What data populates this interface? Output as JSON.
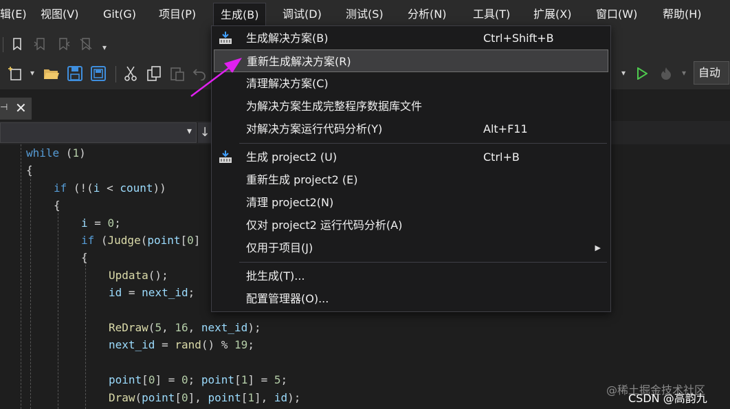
{
  "menubar": {
    "items": [
      {
        "label": "辑(E)"
      },
      {
        "label": "视图(V)"
      },
      {
        "label": "Git(G)"
      },
      {
        "label": "项目(P)"
      },
      {
        "label": "生成(B)"
      },
      {
        "label": "调试(D)"
      },
      {
        "label": "测试(S)"
      },
      {
        "label": "分析(N)"
      },
      {
        "label": "工具(T)"
      },
      {
        "label": "扩展(X)"
      },
      {
        "label": "窗口(W)"
      },
      {
        "label": "帮助(H)"
      }
    ]
  },
  "toolbar": {
    "config_label": "自动",
    "icons": [
      "bookmark-icon",
      "bookmark-prev-icon",
      "bookmark-next-icon",
      "bookmark-clear-icon",
      "overflow-icon",
      "new-project-icon",
      "open-folder-icon",
      "save-icon",
      "save-all-icon",
      "cut-icon",
      "copy-icon",
      "paste-icon",
      "undo-icon",
      "start-icon",
      "hot-reload-icon"
    ]
  },
  "build_menu": {
    "items": [
      {
        "label": "生成解决方案(B)",
        "shortcut": "Ctrl+Shift+B",
        "icon": "build-icon"
      },
      {
        "label": "重新生成解决方案(R)",
        "shortcut": "",
        "highlighted": true
      },
      {
        "label": "清理解决方案(C)",
        "shortcut": ""
      },
      {
        "label": "为解决方案生成完整程序数据库文件",
        "shortcut": ""
      },
      {
        "label": "对解决方案运行代码分析(Y)",
        "shortcut": "Alt+F11"
      },
      {
        "label": "生成 project2 (U)",
        "shortcut": "Ctrl+B",
        "icon": "build-icon"
      },
      {
        "label": "重新生成 project2 (E)",
        "shortcut": ""
      },
      {
        "label": "清理 project2(N)",
        "shortcut": ""
      },
      {
        "label": "仅对 project2 运行代码分析(A)",
        "shortcut": ""
      },
      {
        "label": "仅用于项目(J)",
        "shortcut": "",
        "submenu": true
      },
      {
        "label": "批生成(T)...",
        "shortcut": ""
      },
      {
        "label": "配置管理器(O)...",
        "shortcut": ""
      }
    ]
  },
  "code": {
    "lines": [
      {
        "parts": [
          [
            "kw",
            "while"
          ],
          [
            "pl",
            " ("
          ],
          [
            "num",
            "1"
          ],
          [
            "pl",
            ")"
          ]
        ]
      },
      {
        "parts": [
          [
            "pl",
            "{"
          ]
        ]
      },
      {
        "parts": [
          [
            "kw",
            "if"
          ],
          [
            "pl",
            " (!("
          ],
          [
            "var",
            "i"
          ],
          [
            "pl",
            " < "
          ],
          [
            "var",
            "count"
          ],
          [
            "pl",
            "))"
          ]
        ]
      },
      {
        "parts": [
          [
            "pl",
            "{"
          ]
        ]
      },
      {
        "parts": [
          [
            "var",
            "i"
          ],
          [
            "pl",
            " = "
          ],
          [
            "num",
            "0"
          ],
          [
            "pl",
            ";"
          ]
        ]
      },
      {
        "parts": [
          [
            "kw",
            "if"
          ],
          [
            "pl",
            " ("
          ],
          [
            "fn",
            "Judge"
          ],
          [
            "pl",
            "("
          ],
          [
            "var",
            "point"
          ],
          [
            "pl",
            "["
          ],
          [
            "num",
            "0"
          ],
          [
            "pl",
            "]"
          ]
        ]
      },
      {
        "parts": [
          [
            "pl",
            "{"
          ]
        ]
      },
      {
        "parts": [
          [
            "fn",
            "Updata"
          ],
          [
            "pl",
            "();"
          ]
        ]
      },
      {
        "parts": [
          [
            "var",
            "id"
          ],
          [
            "pl",
            " = "
          ],
          [
            "var",
            "next_id"
          ],
          [
            "pl",
            ";"
          ]
        ]
      },
      {
        "parts": [
          [
            "pl",
            ""
          ]
        ]
      },
      {
        "parts": [
          [
            "fn",
            "ReDraw"
          ],
          [
            "pl",
            "("
          ],
          [
            "num",
            "5"
          ],
          [
            "pl",
            ", "
          ],
          [
            "num",
            "16"
          ],
          [
            "pl",
            ", "
          ],
          [
            "var",
            "next_id"
          ],
          [
            "pl",
            ");"
          ]
        ]
      },
      {
        "parts": [
          [
            "var",
            "next_id"
          ],
          [
            "pl",
            " = "
          ],
          [
            "fn",
            "rand"
          ],
          [
            "pl",
            "() % "
          ],
          [
            "num",
            "19"
          ],
          [
            "pl",
            ";"
          ]
        ]
      },
      {
        "parts": [
          [
            "pl",
            ""
          ]
        ]
      },
      {
        "parts": [
          [
            "var",
            "point"
          ],
          [
            "pl",
            "["
          ],
          [
            "num",
            "0"
          ],
          [
            "pl",
            "] = "
          ],
          [
            "num",
            "0"
          ],
          [
            "pl",
            "; "
          ],
          [
            "var",
            "point"
          ],
          [
            "pl",
            "["
          ],
          [
            "num",
            "1"
          ],
          [
            "pl",
            "] = "
          ],
          [
            "num",
            "5"
          ],
          [
            "pl",
            ";"
          ]
        ]
      },
      {
        "parts": [
          [
            "fn",
            "Draw"
          ],
          [
            "pl",
            "("
          ],
          [
            "var",
            "point"
          ],
          [
            "pl",
            "["
          ],
          [
            "num",
            "0"
          ],
          [
            "pl",
            "], "
          ],
          [
            "var",
            "point"
          ],
          [
            "pl",
            "["
          ],
          [
            "num",
            "1"
          ],
          [
            "pl",
            "], "
          ],
          [
            "var",
            "id"
          ],
          [
            "pl",
            ");"
          ]
        ]
      }
    ]
  },
  "watermark": {
    "line1": "@稀土掘金技术社区",
    "line2": "CSDN @高韵九"
  }
}
